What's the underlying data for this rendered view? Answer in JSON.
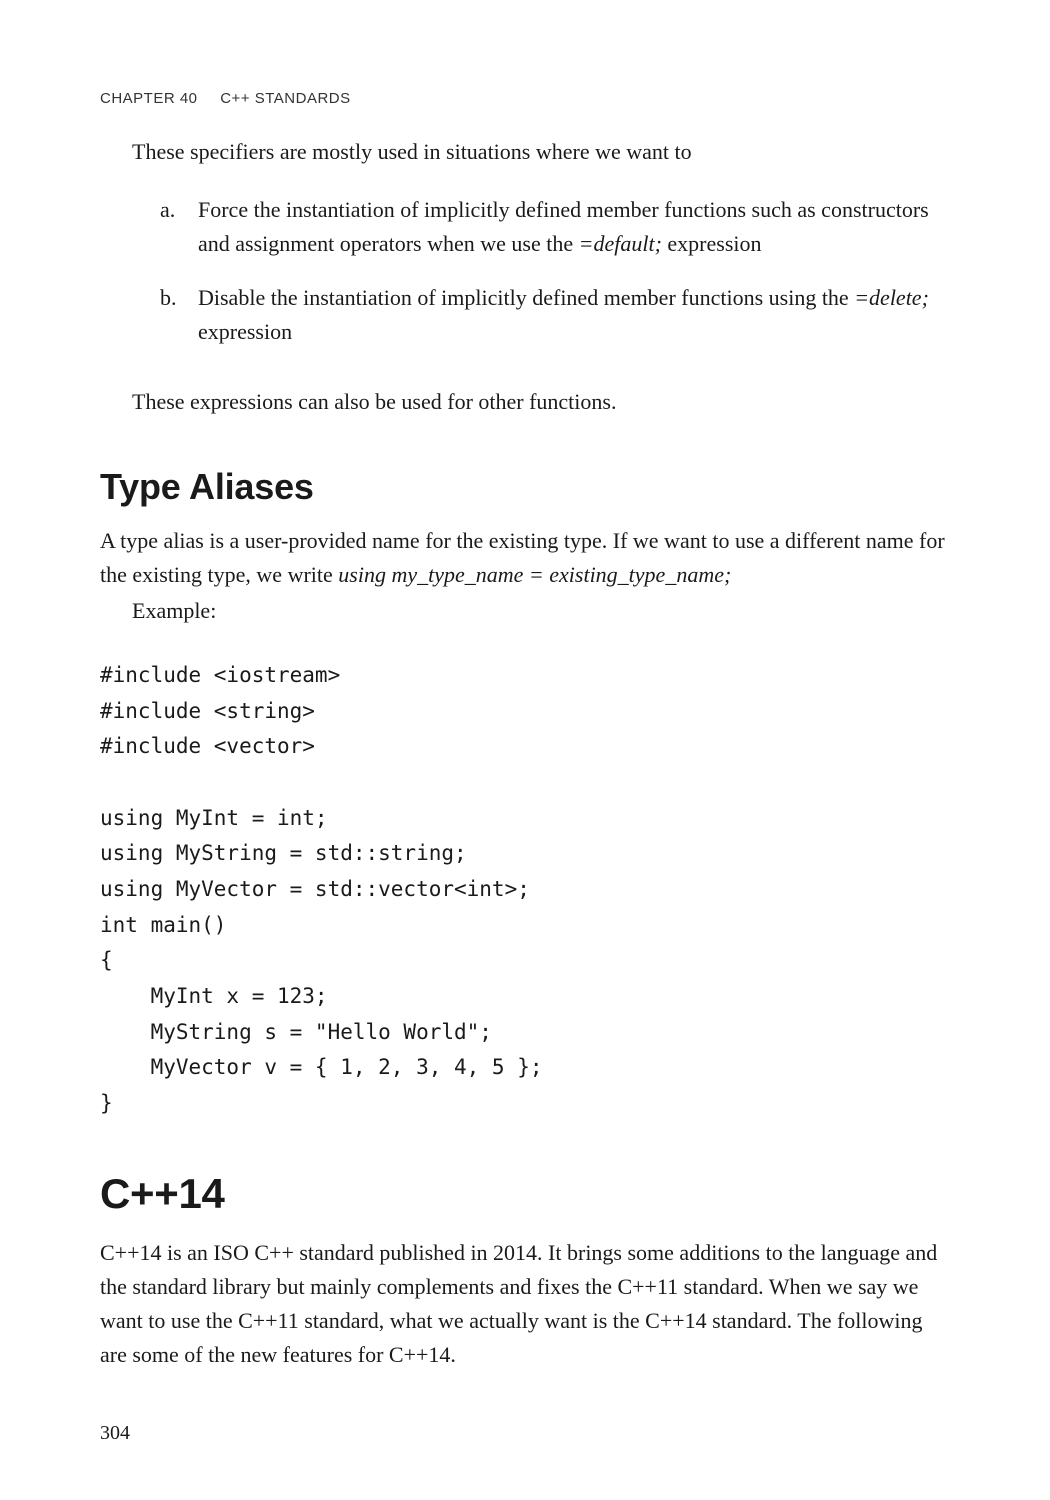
{
  "header": {
    "chapter_label": "CHAPTER 40",
    "chapter_title": "C++ STANDARDS"
  },
  "intro_line": "These specifiers are mostly used in situations where we want to",
  "list": {
    "a": {
      "marker": "a.",
      "pre": "Force the instantiation of implicitly defined member functions such as constructors and assignment operators when we use the ",
      "em": "=default;",
      "post": " expression"
    },
    "b": {
      "marker": "b.",
      "pre": "Disable the instantiation of implicitly defined member functions using the ",
      "em": "=delete;",
      "post": " expression"
    }
  },
  "after_list": "These expressions can also be used for other functions.",
  "type_aliases": {
    "heading": "Type Aliases",
    "para_pre": "A type alias is a user-provided name for the existing type. If we want to use a different name for the existing type, we write ",
    "para_em": "using my_type_name = existing_type_name;",
    "example_label": "Example:",
    "code": "#include <iostream>\n#include <string>\n#include <vector>\n\nusing MyInt = int;\nusing MyString = std::string;\nusing MyVector = std::vector<int>;\nint main()\n{\n    MyInt x = 123;\n    MyString s = \"Hello World\";\n    MyVector v = { 1, 2, 3, 4, 5 };\n}"
  },
  "cpp14": {
    "heading": "C++14",
    "para": "C++14 is an ISO C++ standard published in 2014. It brings some additions to the language and the standard library but mainly complements and fixes the C++11 standard. When we say we want to use the C++11 standard, what we actually want is the C++14 standard. The following are some of the new features for C++14."
  },
  "page_number": "304"
}
